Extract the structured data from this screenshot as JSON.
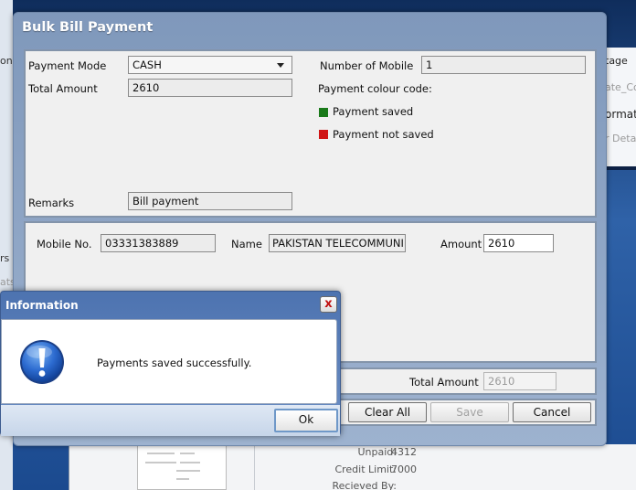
{
  "background": {
    "left_texts": [
      "on",
      "rs",
      "ats"
    ],
    "right_texts": [
      "tage",
      "ate_Co",
      "ormati",
      "r Deta"
    ],
    "lower_rows": [
      {
        "label": "Unpaid:",
        "value": "4312"
      },
      {
        "label": "Credit Limit:",
        "value": "7000"
      },
      {
        "label": "Recieved By:",
        "value": ""
      }
    ]
  },
  "dialog": {
    "title": "Bulk Bill Payment",
    "payment_mode_label": "Payment Mode",
    "payment_mode_value": "CASH",
    "total_amount_label": "Total Amount",
    "total_amount_value": "2610",
    "number_of_mobile_label": "Number of Mobile",
    "number_of_mobile_value": "1",
    "colour_code_label": "Payment colour code:",
    "saved_legend": "Payment saved",
    "not_saved_legend": "Payment not saved",
    "remarks_label": "Remarks",
    "remarks_value": "Bill payment",
    "mobile_no_label": "Mobile No.",
    "mobile_no_value": "03331383889",
    "name_label": "Name",
    "name_value": "PAKISTAN TELECOMMUNI",
    "amount_label": "Amount",
    "amount_value": "2610",
    "footer_total_label": "Total Amount",
    "footer_total_value": "2610",
    "buttons": {
      "clear_all": "Clear All",
      "save": "Save",
      "cancel": "Cancel"
    }
  },
  "info": {
    "title": "Information",
    "close_label": "x",
    "message": "Payments saved successfully.",
    "ok_label": "Ok"
  },
  "colors": {
    "saved": "#1a7a1a",
    "not_saved": "#d01515"
  }
}
